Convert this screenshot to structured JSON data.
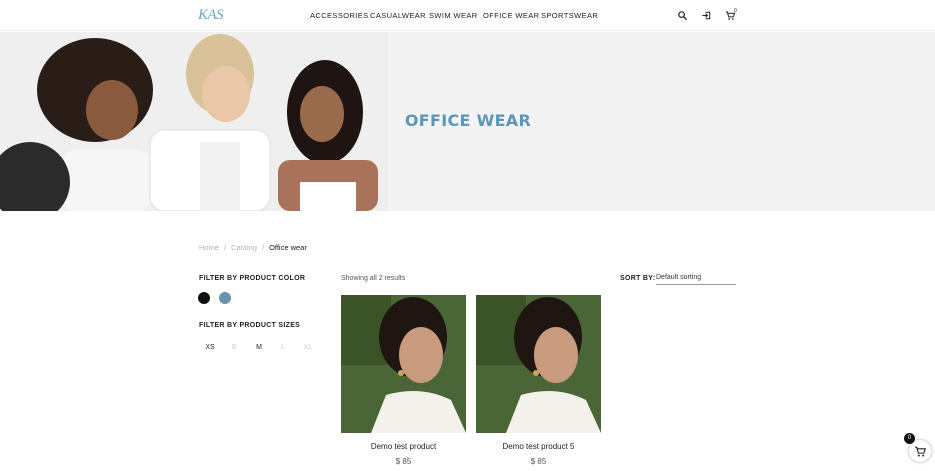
{
  "header": {
    "logo_text": "KAS",
    "nav": [
      "ACCESSORIES",
      "CASUALWEAR",
      "SWIM WEAR",
      "OFFICE WEAR",
      "SPORTSWEAR"
    ],
    "icons": [
      "search-icon",
      "login-icon",
      "cart-icon"
    ],
    "cart_count": "0"
  },
  "hero": {
    "title": "OFFICE WEAR"
  },
  "breadcrumb": {
    "home": "Home",
    "sep1": "/",
    "catalog": "Catalog",
    "sep2": "/",
    "current": "Office wear"
  },
  "filters": {
    "color_title": "FILTER BY PRODUCT COLOR",
    "colors": [
      "#111111",
      "#6a93ad"
    ],
    "size_title": "FILTER BY PRODUCT SIZES",
    "sizes": [
      "XS",
      "S",
      "M",
      "L",
      "XL"
    ]
  },
  "results": {
    "text": "Showing all 2 results",
    "sort_label": "SORT BY:",
    "sort_value": "Default sorting"
  },
  "products": [
    {
      "name": "Demo test product",
      "price": "$ 85"
    },
    {
      "name": "Demo test product 5",
      "price": "$ 85"
    }
  ],
  "floating_cart": {
    "count": "0"
  }
}
